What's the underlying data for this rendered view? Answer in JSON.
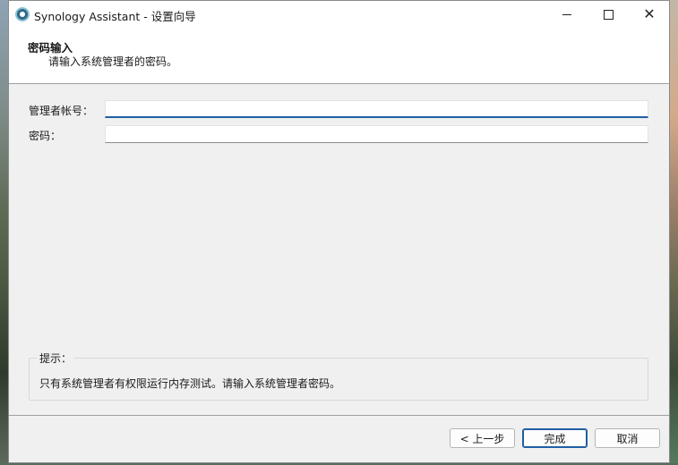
{
  "window": {
    "title": "Synology Assistant  - 设置向导",
    "icon": "synology-assistant-icon"
  },
  "header": {
    "title": "密码输入",
    "subtitle": "请输入系统管理者的密码。"
  },
  "form": {
    "account_label": "管理者帐号：",
    "account_value": "",
    "password_label": "密码：",
    "password_value": ""
  },
  "hint": {
    "title": "提示：",
    "text": "只有系统管理者有权限运行内存测试。请输入系统管理者密码。"
  },
  "buttons": {
    "back": "< 上一步",
    "finish": "完成",
    "cancel": "取消"
  },
  "colors": {
    "accent": "#1f5fa3",
    "window_bg": "#f0f0f0",
    "header_bg": "#ffffff"
  }
}
